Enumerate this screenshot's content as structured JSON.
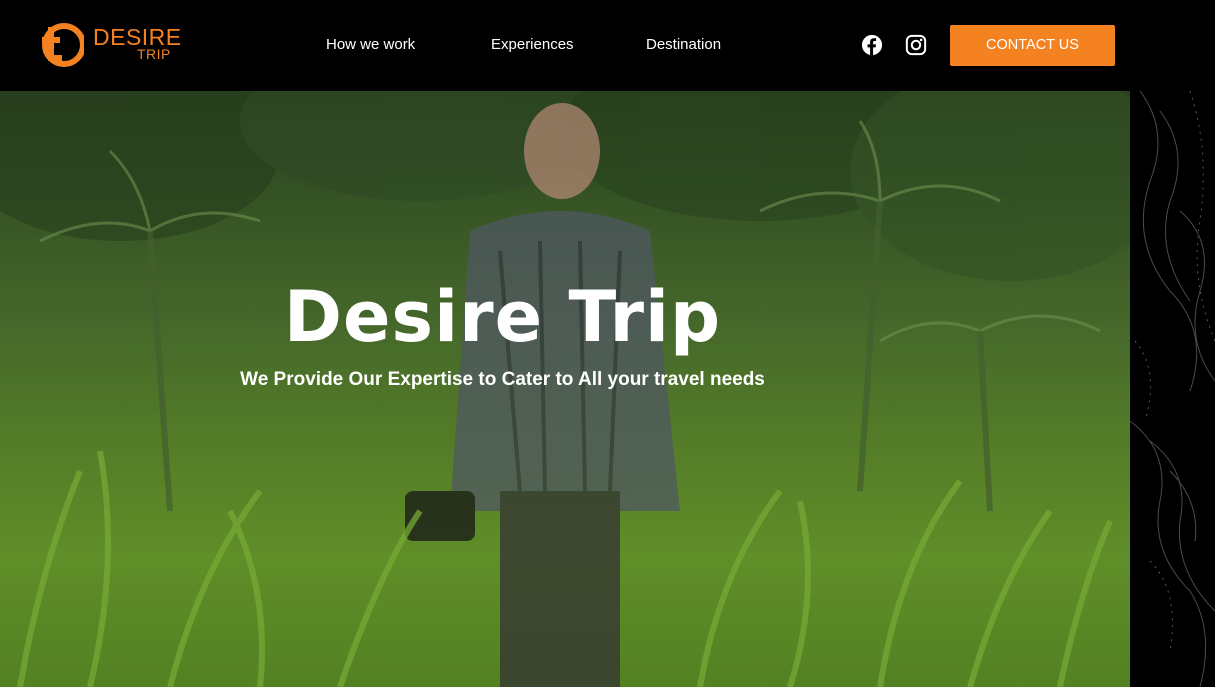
{
  "brand": {
    "name_line1": "DESIRE",
    "name_line2": "TRIP",
    "accent_color": "#f58220"
  },
  "nav": {
    "items": [
      {
        "label": "How we work"
      },
      {
        "label": "Experiences"
      },
      {
        "label": "Destination"
      }
    ]
  },
  "social": {
    "icons": [
      "facebook-icon",
      "instagram-icon"
    ]
  },
  "header": {
    "contact_label": "CONTACT US"
  },
  "hero": {
    "title": "Desire Trip",
    "subtitle": "We Provide Our Expertise to Cater to All your travel needs"
  }
}
